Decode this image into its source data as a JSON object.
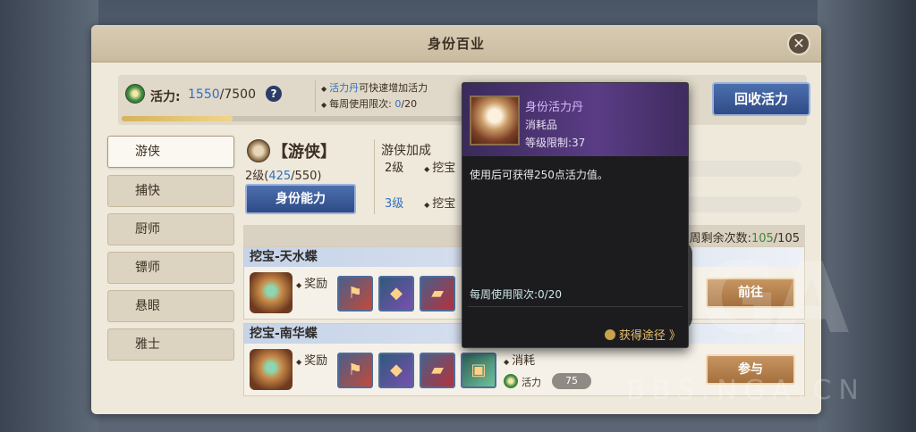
{
  "window": {
    "title": "身份百业"
  },
  "vitality": {
    "label": "活力:",
    "current": "1550",
    "max": "/7500",
    "help": "?",
    "progress": 0.207,
    "tips": [
      {
        "hl": "活力丹",
        "rest": "可快速增加活力"
      },
      {
        "prefix": "每周使用限次: ",
        "hl": "0",
        "rest": "/20"
      }
    ],
    "recover_button": "回收活力"
  },
  "sidebar": {
    "items": [
      {
        "label": "游侠",
        "active": true
      },
      {
        "label": "捕快"
      },
      {
        "label": "厨师"
      },
      {
        "label": "镖师"
      },
      {
        "label": "悬眼"
      },
      {
        "label": "雅士"
      }
    ]
  },
  "identity": {
    "name": "【游侠】",
    "level_prefix": "2级(",
    "level_cur": "425",
    "level_rest": "/550)",
    "ability_button": "身份能力",
    "bonus_title": "游侠加成",
    "bonuses": [
      {
        "level": "2级",
        "text": "挖宝"
      },
      {
        "level": "3级",
        "text": "挖宝"
      }
    ]
  },
  "tasks_header": {
    "remain_label": "周剩余次数:",
    "remain_cur": "105",
    "remain_max": "/105"
  },
  "tasks": [
    {
      "title": "挖宝-天水蝶",
      "reward_label": "奖励",
      "button": "前往"
    },
    {
      "title": "挖宝-南华蝶",
      "reward_label": "奖励",
      "cost_label": "消耗",
      "cost_name": "活力",
      "cost_value": "75",
      "button": "参与"
    }
  ],
  "tooltip": {
    "name": "身份活力丹",
    "type": "消耗品",
    "level": "等级限制:37",
    "description": "使用后可获得250点活力值。",
    "weekly_limit": "每周使用限次:0/20",
    "obtain_link": "获得途径 》"
  },
  "watermark": {
    "brand": "GA",
    "url": "BBS.NGA.CN"
  },
  "colors": {
    "accent_blue": "#2f70c2",
    "button_blue": "#2f4b86",
    "button_gold": "#a4703e",
    "tooltip_bg": "#1c1c1e"
  }
}
